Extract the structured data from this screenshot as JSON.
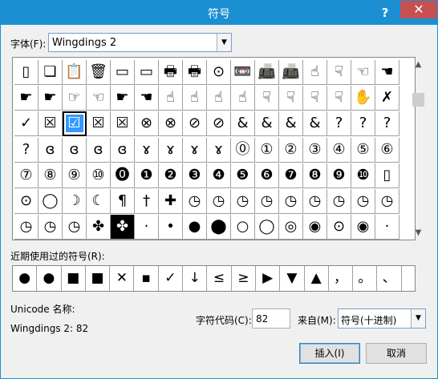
{
  "window": {
    "title": "符号",
    "help": "?",
    "close": "✕"
  },
  "font": {
    "label": "字体(F):",
    "value": "Wingdings 2"
  },
  "grid_rows": [
    [
      "▯",
      "❏",
      "📋",
      "🗑",
      "▭",
      "▭",
      "🖶",
      "🖶",
      "⊙",
      "📼",
      "📠",
      "📠",
      "☝",
      "☟",
      "☜",
      "☚"
    ],
    [
      "☛",
      "☛",
      "☞",
      "☜",
      "☛",
      "☚",
      "☝",
      "☝",
      "☝",
      "☝",
      "☟",
      "☟",
      "☟",
      "☟",
      "✋",
      "✗"
    ],
    [
      "✓",
      "☒",
      "☑",
      "☒",
      "☒",
      "⊗",
      "⊗",
      "⊘",
      "⊘",
      "&",
      "&",
      "&",
      "&",
      "?",
      "?",
      "?"
    ],
    [
      "?",
      "ɞ",
      "ɞ",
      "ɞ",
      "ɞ",
      "ɤ",
      "ɤ",
      "ɤ",
      "ɤ",
      "⓪",
      "①",
      "②",
      "③",
      "④",
      "⑤",
      "⑥"
    ],
    [
      "⑦",
      "⑧",
      "⑨",
      "⑩",
      "⓿",
      "❶",
      "❷",
      "❸",
      "❹",
      "❺",
      "❻",
      "❼",
      "❽",
      "❾",
      "❿",
      "▯"
    ],
    [
      "⊙",
      "◯",
      "☽",
      "☾",
      "¶",
      "†",
      "✚",
      "◷",
      "◷",
      "◷",
      "◷",
      "◷",
      "◷",
      "◷",
      "◷",
      "◷"
    ],
    [
      "◷",
      "◷",
      "◷",
      "✤",
      "✤",
      "·",
      "•",
      "●",
      "⬤",
      "○",
      "◯",
      "◎",
      "◉",
      "⊙",
      "◉",
      "·"
    ]
  ],
  "recent_label": "近期使用过的符号(R):",
  "recent": [
    "●",
    "●",
    "■",
    "■",
    "✕",
    "▪",
    "✓",
    "↓",
    "≤",
    "≥",
    "▶",
    "▼",
    "▲",
    "，",
    "。",
    "、"
  ],
  "unicode_name_label": "Unicode 名称:",
  "char_name": "Wingdings 2: 82",
  "char_code_label": "字符代码(C):",
  "char_code_value": "82",
  "from_label": "来自(M):",
  "from_value": "符号(十进制)",
  "insert_label": "插入(I)",
  "cancel_label": "取消"
}
